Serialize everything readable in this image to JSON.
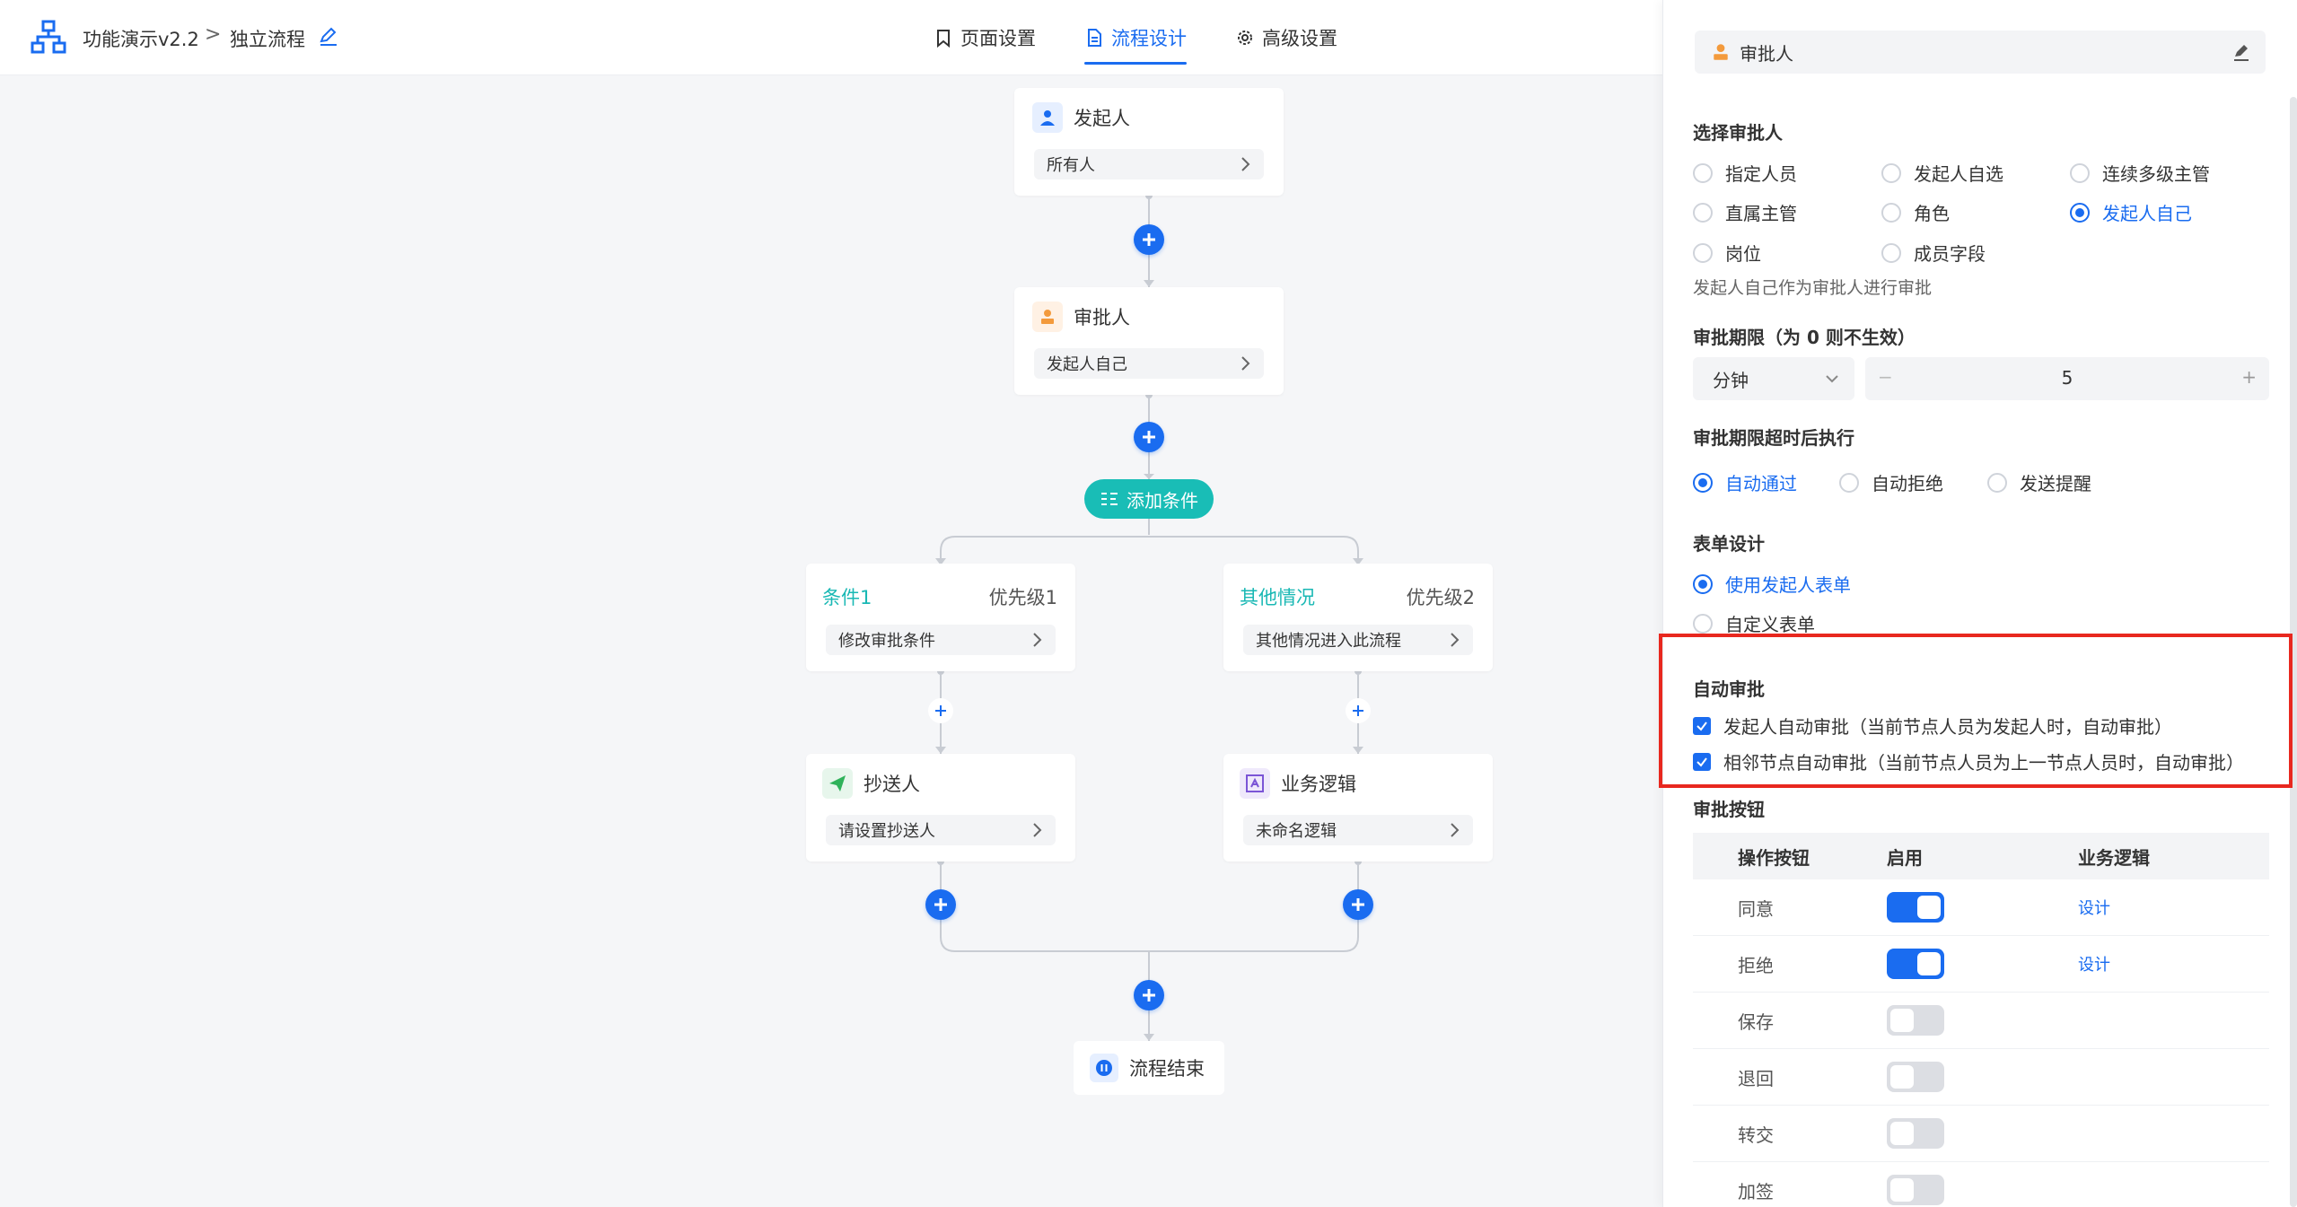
{
  "header": {
    "app_title": "功能演示v2.2",
    "crumb_sep": ">",
    "flow_name": "独立流程",
    "tabs": [
      {
        "label": "页面设置",
        "active": false
      },
      {
        "label": "流程设计",
        "active": true
      },
      {
        "label": "高级设置",
        "active": false
      }
    ]
  },
  "flow": {
    "start": {
      "title": "发起人",
      "value": "所有人"
    },
    "approver": {
      "title": "审批人",
      "value": "发起人自己"
    },
    "add_condition": "添加条件",
    "branches": [
      {
        "name": "条件1",
        "priority": "优先级1",
        "value": "修改审批条件",
        "child": {
          "title": "抄送人",
          "value": "请设置抄送人"
        }
      },
      {
        "name": "其他情况",
        "priority": "优先级2",
        "value": "其他情况进入此流程",
        "child": {
          "title": "业务逻辑",
          "value": "未命名逻辑"
        }
      }
    ],
    "end": "流程结束"
  },
  "panel": {
    "node_title": "审批人",
    "select_approver": {
      "title": "选择审批人",
      "options": [
        "指定人员",
        "发起人自选",
        "连续多级主管",
        "直属主管",
        "角色",
        "发起人自己",
        "岗位",
        "成员字段"
      ],
      "selected": "发起人自己",
      "hint": "发起人自己作为审批人进行审批"
    },
    "deadline": {
      "title": "审批期限（为 0 则不生效）",
      "unit": "分钟",
      "value": "5",
      "minus": "−",
      "plus": "+"
    },
    "timeout": {
      "title": "审批期限超时后执行",
      "options": [
        "自动通过",
        "自动拒绝",
        "发送提醒"
      ],
      "selected": "自动通过"
    },
    "form": {
      "title": "表单设计",
      "options": [
        "使用发起人表单",
        "自定义表单"
      ],
      "selected": "使用发起人表单"
    },
    "auto": {
      "title": "自动审批",
      "items": [
        "发起人自动审批（当前节点人员为发起人时，自动审批）",
        "相邻节点自动审批（当前节点人员为上一节点人员时，自动审批）"
      ]
    },
    "buttons": {
      "title": "审批按钮",
      "headers": [
        "操作按钮",
        "启用",
        "业务逻辑"
      ],
      "rows": [
        {
          "name": "同意",
          "on": true,
          "link": "设计"
        },
        {
          "name": "拒绝",
          "on": true,
          "link": "设计"
        },
        {
          "name": "保存",
          "on": false,
          "link": ""
        },
        {
          "name": "退回",
          "on": false,
          "link": ""
        },
        {
          "name": "转交",
          "on": false,
          "link": ""
        },
        {
          "name": "加签",
          "on": false,
          "link": ""
        }
      ]
    }
  },
  "colors": {
    "accent": "#1a6cf0",
    "teal": "#19bdb6",
    "highlight": "#e8281f"
  }
}
